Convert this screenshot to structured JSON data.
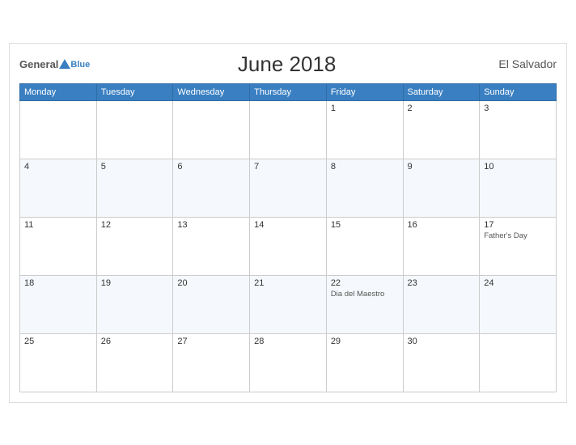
{
  "header": {
    "logo_general": "General",
    "logo_blue": "Blue",
    "title": "June 2018",
    "country": "El Salvador"
  },
  "weekdays": [
    "Monday",
    "Tuesday",
    "Wednesday",
    "Thursday",
    "Friday",
    "Saturday",
    "Sunday"
  ],
  "weeks": [
    [
      {
        "day": "",
        "event": ""
      },
      {
        "day": "",
        "event": ""
      },
      {
        "day": "",
        "event": ""
      },
      {
        "day": "",
        "event": ""
      },
      {
        "day": "1",
        "event": ""
      },
      {
        "day": "2",
        "event": ""
      },
      {
        "day": "3",
        "event": ""
      }
    ],
    [
      {
        "day": "4",
        "event": ""
      },
      {
        "day": "5",
        "event": ""
      },
      {
        "day": "6",
        "event": ""
      },
      {
        "day": "7",
        "event": ""
      },
      {
        "day": "8",
        "event": ""
      },
      {
        "day": "9",
        "event": ""
      },
      {
        "day": "10",
        "event": ""
      }
    ],
    [
      {
        "day": "11",
        "event": ""
      },
      {
        "day": "12",
        "event": ""
      },
      {
        "day": "13",
        "event": ""
      },
      {
        "day": "14",
        "event": ""
      },
      {
        "day": "15",
        "event": ""
      },
      {
        "day": "16",
        "event": ""
      },
      {
        "day": "17",
        "event": "Father's Day"
      }
    ],
    [
      {
        "day": "18",
        "event": ""
      },
      {
        "day": "19",
        "event": ""
      },
      {
        "day": "20",
        "event": ""
      },
      {
        "day": "21",
        "event": ""
      },
      {
        "day": "22",
        "event": "Dia del Maestro"
      },
      {
        "day": "23",
        "event": ""
      },
      {
        "day": "24",
        "event": ""
      }
    ],
    [
      {
        "day": "25",
        "event": ""
      },
      {
        "day": "26",
        "event": ""
      },
      {
        "day": "27",
        "event": ""
      },
      {
        "day": "28",
        "event": ""
      },
      {
        "day": "29",
        "event": ""
      },
      {
        "day": "30",
        "event": ""
      },
      {
        "day": "",
        "event": ""
      }
    ]
  ]
}
